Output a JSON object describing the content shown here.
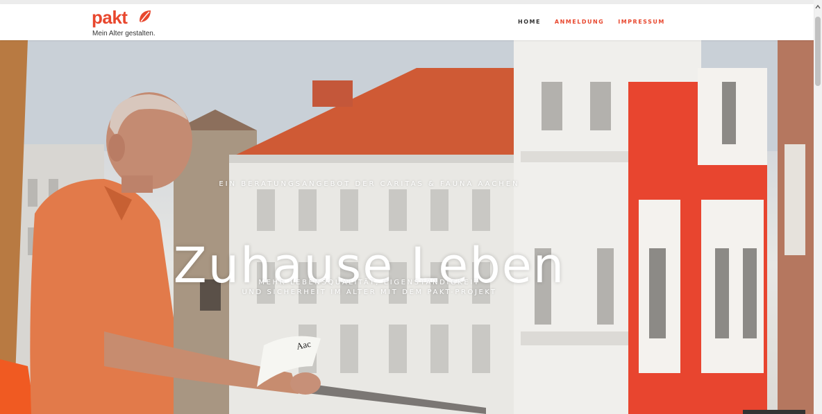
{
  "brand": {
    "name": "pakt",
    "tagline": "Mein Alter gestalten.",
    "color": "#e8472e"
  },
  "nav": {
    "items": [
      {
        "label": "HOME"
      },
      {
        "label": "ANMELDUNG"
      },
      {
        "label": "IMPRESSUM"
      }
    ]
  },
  "hero": {
    "kicker": "EIN BERATUNGSANGEBOT DER CARITAS & FAUNA AACHEN",
    "title": "Zuhause Leben",
    "desc_line1": "MEHR LEBENSQUALITÄT, EIGENSTÄNDIGKEIT",
    "desc_line2": "UND SICHERHEIT IM ALTER MIT DEM PAKT-PROJEKT",
    "newspaper_text": "Aac"
  },
  "scrollbar": {
    "up_icon": "chevron-up-icon"
  }
}
